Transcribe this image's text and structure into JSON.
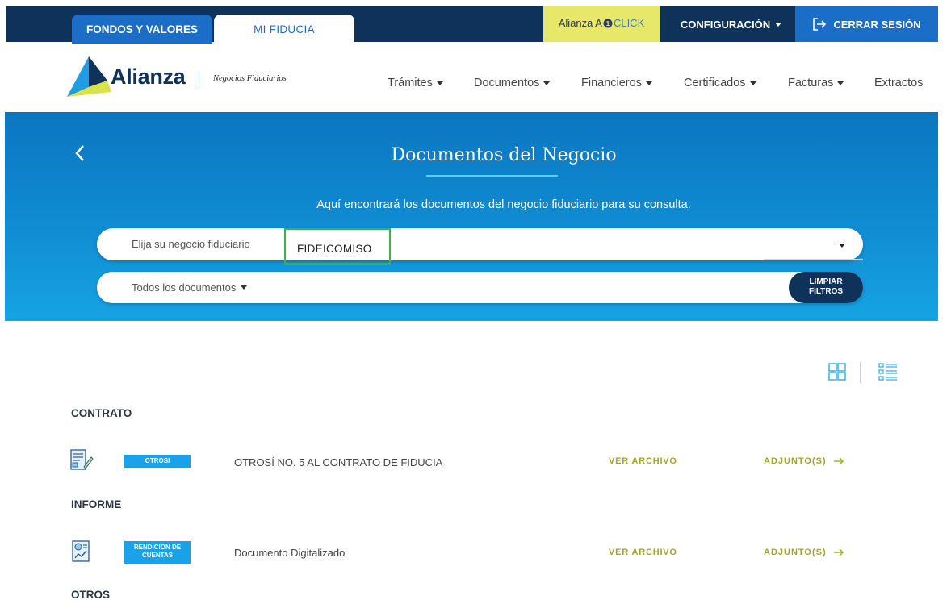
{
  "topbar": {
    "tabs": [
      {
        "label": "FONDOS Y VALORES"
      },
      {
        "label": "MI FIDUCIA"
      }
    ],
    "alianza_click": {
      "prefix": "Alianza A",
      "suffix": "CLICK"
    },
    "config_label": "CONFIGURACIÓN",
    "logout_label": "CERRAR SESIÓN"
  },
  "header": {
    "logo_text": "Alianza",
    "logo_subtitle": "Negocios Fiduciarios",
    "nav": [
      {
        "label": "Trámites"
      },
      {
        "label": "Documentos"
      },
      {
        "label": "Financieros"
      },
      {
        "label": "Certificados"
      },
      {
        "label": "Facturas"
      },
      {
        "label": "Extractos"
      }
    ]
  },
  "hero": {
    "title": "Documentos del Negocio",
    "subtitle": "Aquí encontrará los documentos del negocio fiduciario para su consulta.",
    "business_select": {
      "label": "Elija su negocio fiduciario",
      "value": "FIDEICOMISO"
    },
    "doc_filter": {
      "label": "Todos los documentos"
    },
    "clear_button": {
      "line1": "LIMPIAR",
      "line2": "FILTROS"
    }
  },
  "sections": [
    {
      "title": "CONTRATO",
      "rows": [
        {
          "badge": "OTROSI",
          "name": "OTROSÍ NO. 5 AL CONTRATO DE FIDUCIA",
          "view": "VER ARCHIVO",
          "attach": "ADJUNTO(S)"
        }
      ]
    },
    {
      "title": "INFORME",
      "rows": [
        {
          "badge_line1": "RENDICION DE",
          "badge_line2": "CUENTAS",
          "name": "Documento Digitalizado",
          "view": "VER ARCHIVO",
          "attach": "ADJUNTO(S)"
        }
      ]
    },
    {
      "title": "OTROS",
      "rows": []
    }
  ],
  "colors": {
    "navy": "#0e3259",
    "tab_blue": "#1a6ec7",
    "click_yellow": "#e7e86a",
    "badge_blue": "#18a3e8",
    "link_olive": "#a1a52a",
    "highlight_green": "#3cb34a"
  }
}
